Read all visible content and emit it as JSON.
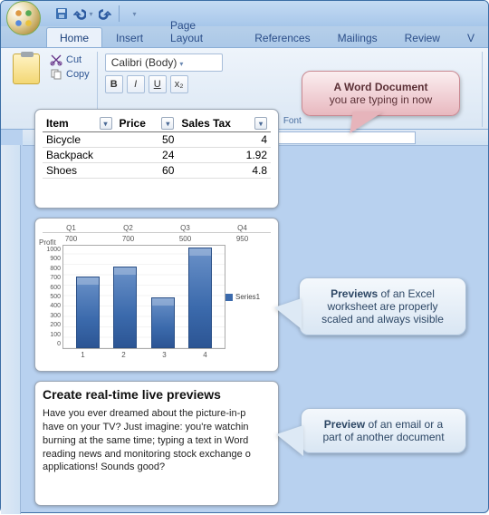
{
  "qat": {
    "save": "💾",
    "undo": "↶",
    "redo": "↷"
  },
  "tabs": {
    "home": "Home",
    "insert": "Insert",
    "pagelayout": "Page Layout",
    "references": "References",
    "mailings": "Mailings",
    "review": "Review",
    "v": "V"
  },
  "ribbon": {
    "paste_label": "",
    "cut": "Cut",
    "copy": "Copy",
    "font_name": "Calibri (Body)",
    "font_group_label": "Font",
    "x2": "x₂"
  },
  "table": {
    "headers": {
      "item": "Item",
      "price": "Price",
      "tax": "Sales Tax"
    },
    "rows": [
      {
        "item": "Bicycle",
        "price": "50",
        "tax": "4"
      },
      {
        "item": "Backpack",
        "price": "24",
        "tax": "1.92"
      },
      {
        "item": "Shoes",
        "price": "60",
        "tax": "4.8"
      }
    ]
  },
  "chart_data": {
    "type": "bar",
    "profit_label": "Profit",
    "quarters": [
      "Q1",
      "Q2",
      "Q3",
      "Q4"
    ],
    "quarter_values": [
      "700",
      "700",
      "500",
      "950"
    ],
    "categories": [
      "1",
      "2",
      "3",
      "4"
    ],
    "values": [
      700,
      800,
      500,
      980
    ],
    "y_ticks": [
      "1000",
      "900",
      "800",
      "700",
      "600",
      "500",
      "400",
      "300",
      "200",
      "100",
      "0"
    ],
    "ylim": [
      0,
      1000
    ],
    "legend": "Series1"
  },
  "article": {
    "title": "Create real-time live previews",
    "body": "Have you ever dreamed about the picture-in-p\nhave on your TV? Just imagine: you're watchin\nburning at the same time; typing a text in Word\nreading news and monitoring stock exchange o\napplications! Sounds good?"
  },
  "callouts": {
    "pink_bold": "A Word Document",
    "pink_rest": "you are typing in now",
    "blue1_bold": "Previews",
    "blue1_rest": " of an Excel worksheet are properly scaled and always visible",
    "blue2_bold": "Preview",
    "blue2_rest": " of an email or a part of another document"
  }
}
